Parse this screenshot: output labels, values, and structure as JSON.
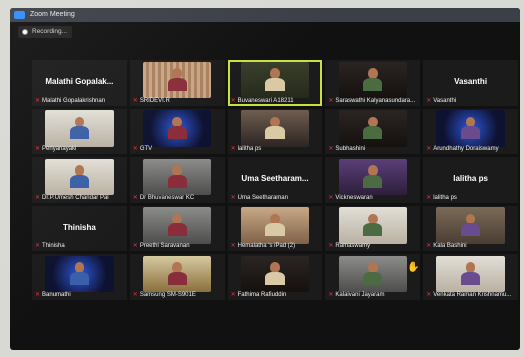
{
  "window": {
    "title": "Zoom Meeting"
  },
  "recording": {
    "label": "Recording..."
  },
  "colors": {
    "active_speaker": "#c6e23b",
    "mic_muted": "#e0343a",
    "zoom_blue": "#2d8cff"
  },
  "participants": [
    {
      "display_name": "Malathi  Gopalak...",
      "label": "Malathi Gopalakrishnan",
      "video": false
    },
    {
      "display_name": "",
      "label": "SRIDEVI.R",
      "video": true
    },
    {
      "display_name": "",
      "label": "Buvaneswari A18211",
      "video": true,
      "active": true
    },
    {
      "display_name": "",
      "label": "Saraswathi Kalyanasundara...",
      "video": true
    },
    {
      "display_name": "Vasanthi",
      "label": "Vasanthi",
      "video": false
    },
    {
      "display_name": "",
      "label": "Periyanayaki",
      "video": true
    },
    {
      "display_name": "",
      "label": "GTV",
      "video": true
    },
    {
      "display_name": "",
      "label": "lalitha ps",
      "video": true
    },
    {
      "display_name": "",
      "label": "Subhashini",
      "video": true
    },
    {
      "display_name": "",
      "label": "Arundhathy Doraiswamy",
      "video": true
    },
    {
      "display_name": "",
      "label": "Dr.P.Umesh Chandar Pal",
      "video": true
    },
    {
      "display_name": "",
      "label": "Dr Bhuvaneswar KC",
      "video": true
    },
    {
      "display_name": "Uma  Seetharam...",
      "label": "Uma Seetharaman",
      "video": false
    },
    {
      "display_name": "",
      "label": "Vickneswaran",
      "video": true
    },
    {
      "display_name": "lalitha ps",
      "label": "lalitha ps",
      "video": false
    },
    {
      "display_name": "Thinisha",
      "label": "Thinisha",
      "video": false
    },
    {
      "display_name": "",
      "label": "Preethi Saravanan",
      "video": true
    },
    {
      "display_name": "",
      "label": "Hemalatha 's iPad (2)",
      "video": true
    },
    {
      "display_name": "",
      "label": "Ramaswamy",
      "video": true
    },
    {
      "display_name": "",
      "label": "Kala Bashini",
      "video": true
    },
    {
      "display_name": "",
      "label": "Banumathi",
      "video": true
    },
    {
      "display_name": "",
      "label": "Samsung SM-S901E",
      "video": true
    },
    {
      "display_name": "",
      "label": "Fathima Rafiuddin",
      "video": true
    },
    {
      "display_name": "",
      "label": "Kalaivani Jayaram",
      "video": true
    },
    {
      "display_name": "",
      "label": "Venkata Raman Krishnamu...",
      "video": true
    }
  ]
}
